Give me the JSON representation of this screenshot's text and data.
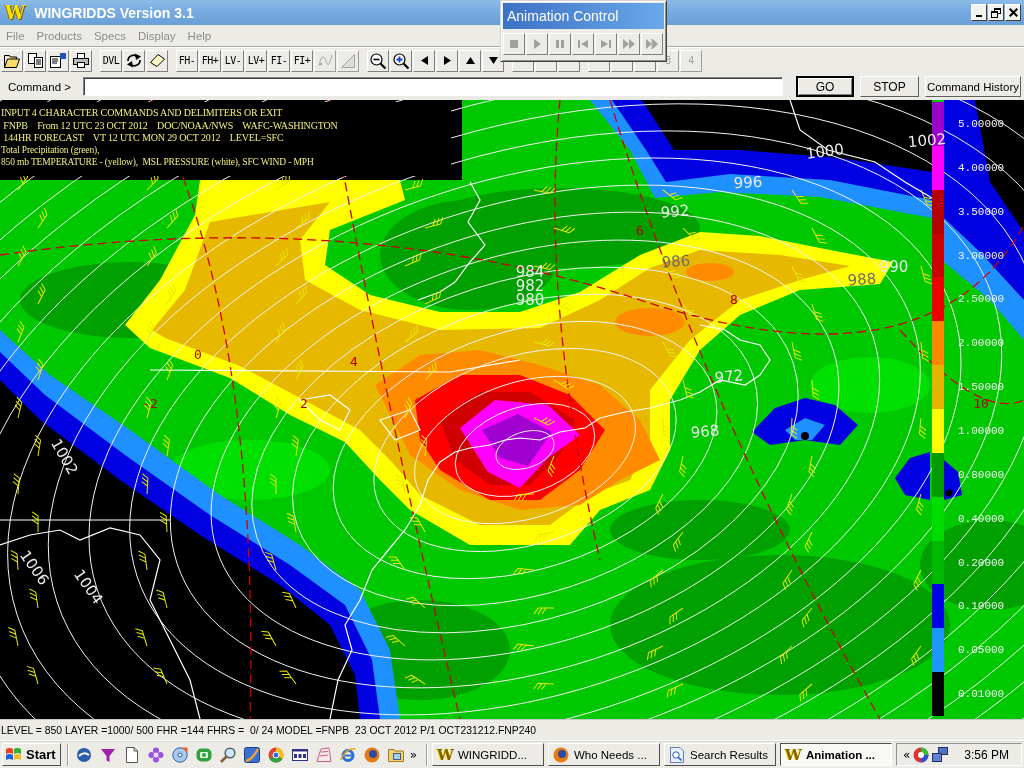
{
  "window": {
    "logo": "W",
    "title": "WINGRIDDS Version 3.1"
  },
  "menu": [
    "File",
    "Products",
    "Specs",
    "Display",
    "Help"
  ],
  "toolbar": [
    [
      {
        "kind": "icon",
        "disabled": false
      },
      {
        "kind": "icon",
        "disabled": false
      },
      {
        "kind": "icon",
        "disabled": false
      },
      {
        "kind": "icon",
        "disabled": false
      }
    ],
    [
      {
        "kind": "text",
        "label": "DVL",
        "disabled": false
      },
      {
        "kind": "icon",
        "disabled": false
      },
      {
        "kind": "icon",
        "disabled": false
      }
    ],
    [
      {
        "kind": "text",
        "label": "FH-",
        "disabled": false
      },
      {
        "kind": "text",
        "label": "FH+",
        "disabled": false
      },
      {
        "kind": "text",
        "label": "LV-",
        "disabled": false
      },
      {
        "kind": "text",
        "label": "LV+",
        "disabled": false
      },
      {
        "kind": "text",
        "label": "FI-",
        "disabled": false
      },
      {
        "kind": "text",
        "label": "FI+",
        "disabled": false
      },
      {
        "kind": "icon",
        "disabled": true
      },
      {
        "kind": "icon",
        "disabled": true
      }
    ],
    [
      {
        "kind": "icon",
        "disabled": false
      },
      {
        "kind": "icon",
        "disabled": false
      },
      {
        "kind": "icon",
        "disabled": false
      },
      {
        "kind": "icon",
        "disabled": false
      },
      {
        "kind": "icon",
        "disabled": false
      },
      {
        "kind": "icon",
        "disabled": false
      }
    ],
    [
      {
        "kind": "blank",
        "disabled": false
      },
      {
        "kind": "blank",
        "disabled": false
      },
      {
        "kind": "blank",
        "disabled": false
      }
    ],
    [
      {
        "kind": "blank",
        "disabled": false
      },
      {
        "kind": "blank",
        "disabled": false
      },
      {
        "kind": "blank",
        "disabled": false
      },
      {
        "kind": "text",
        "label": "3",
        "disabled": true
      },
      {
        "kind": "text",
        "label": "4",
        "disabled": true
      }
    ]
  ],
  "animation_control": {
    "title": "Animation Control",
    "buttons": [
      {
        "disabled": true
      },
      {
        "disabled": true
      },
      {
        "disabled": true
      },
      {
        "disabled": true
      },
      {
        "disabled": true
      },
      {
        "disabled": true
      },
      {
        "disabled": true
      }
    ]
  },
  "command": {
    "label": "Command >",
    "buttons": [
      {
        "label": "GO",
        "default": true
      },
      {
        "label": "STOP",
        "default": false
      },
      {
        "label": "Command History",
        "default": false
      }
    ]
  },
  "map": {
    "header_lines": [
      "INPUT 4 CHARACTER COMMANDS AND DELIMITERS OR EXIT",
      " FNPB    From 12 UTC 23 OCT 2012    DOC/NOAA/NWS    WAFC-WASHINGTON",
      " 144HR FORECAST    VT 12 UTC MON 29 OCT 2012    LEVEL=SFC",
      "Total Precipitation (green),",
      "850 mb TEMPERATURE - (yellow),  MSL PRESSURE (white), SFC WIND - MPH"
    ],
    "isobar_labels": [
      "1000",
      "1002",
      "996",
      "992",
      "984",
      "982",
      "980",
      "990",
      "968",
      "1002",
      "1004",
      "1006",
      "986",
      "988",
      "972"
    ],
    "isotherm_labels": [
      "6",
      "8",
      "0",
      "4",
      "-2",
      "2",
      "10"
    ],
    "precipitation_scale": [
      {
        "label": "5.00000",
        "color": "#9c00cc"
      },
      {
        "label": "4.00000",
        "color": "#ff00ff"
      },
      {
        "label": "3.50000",
        "color": "#b40000"
      },
      {
        "label": "3.00000",
        "color": "#cc0000"
      },
      {
        "label": "2.50000",
        "color": "#ee0000"
      },
      {
        "label": "2.00000",
        "color": "#ff8800"
      },
      {
        "label": "1.50000",
        "color": "#e6b400"
      },
      {
        "label": "1.00000",
        "color": "#ffff00"
      },
      {
        "label": "0.80000",
        "color": "#009c00"
      },
      {
        "label": "0.40000",
        "color": "#00dc00"
      },
      {
        "label": "0.20000",
        "color": "#00b800"
      },
      {
        "label": "0.10000",
        "color": "#0000e6"
      },
      {
        "label": "0.05000",
        "color": "#1e96ff"
      },
      {
        "label": "0.01000",
        "color": "#000000"
      }
    ]
  },
  "status_bar": "LEVEL = 850 LAYER =1000/ 500 FHR =144 FHRS =  0/ 24 MODEL =FNPB  23 OCT 2012 P/1 OCT231212.FNP240",
  "taskbar": {
    "start": "Start",
    "more": "»",
    "tasks": [
      {
        "kind": "letter",
        "logo": "W",
        "label": "WINGRIDD...",
        "selected": false
      },
      {
        "kind": "orb",
        "label": "Who Needs ...",
        "selected": false
      },
      {
        "kind": "document",
        "label": "Search Results",
        "selected": false
      },
      {
        "kind": "letter",
        "logo": "W",
        "label": "Animation ...",
        "selected": true
      }
    ],
    "tray_toggle": "«",
    "clock": "3:56 PM"
  }
}
